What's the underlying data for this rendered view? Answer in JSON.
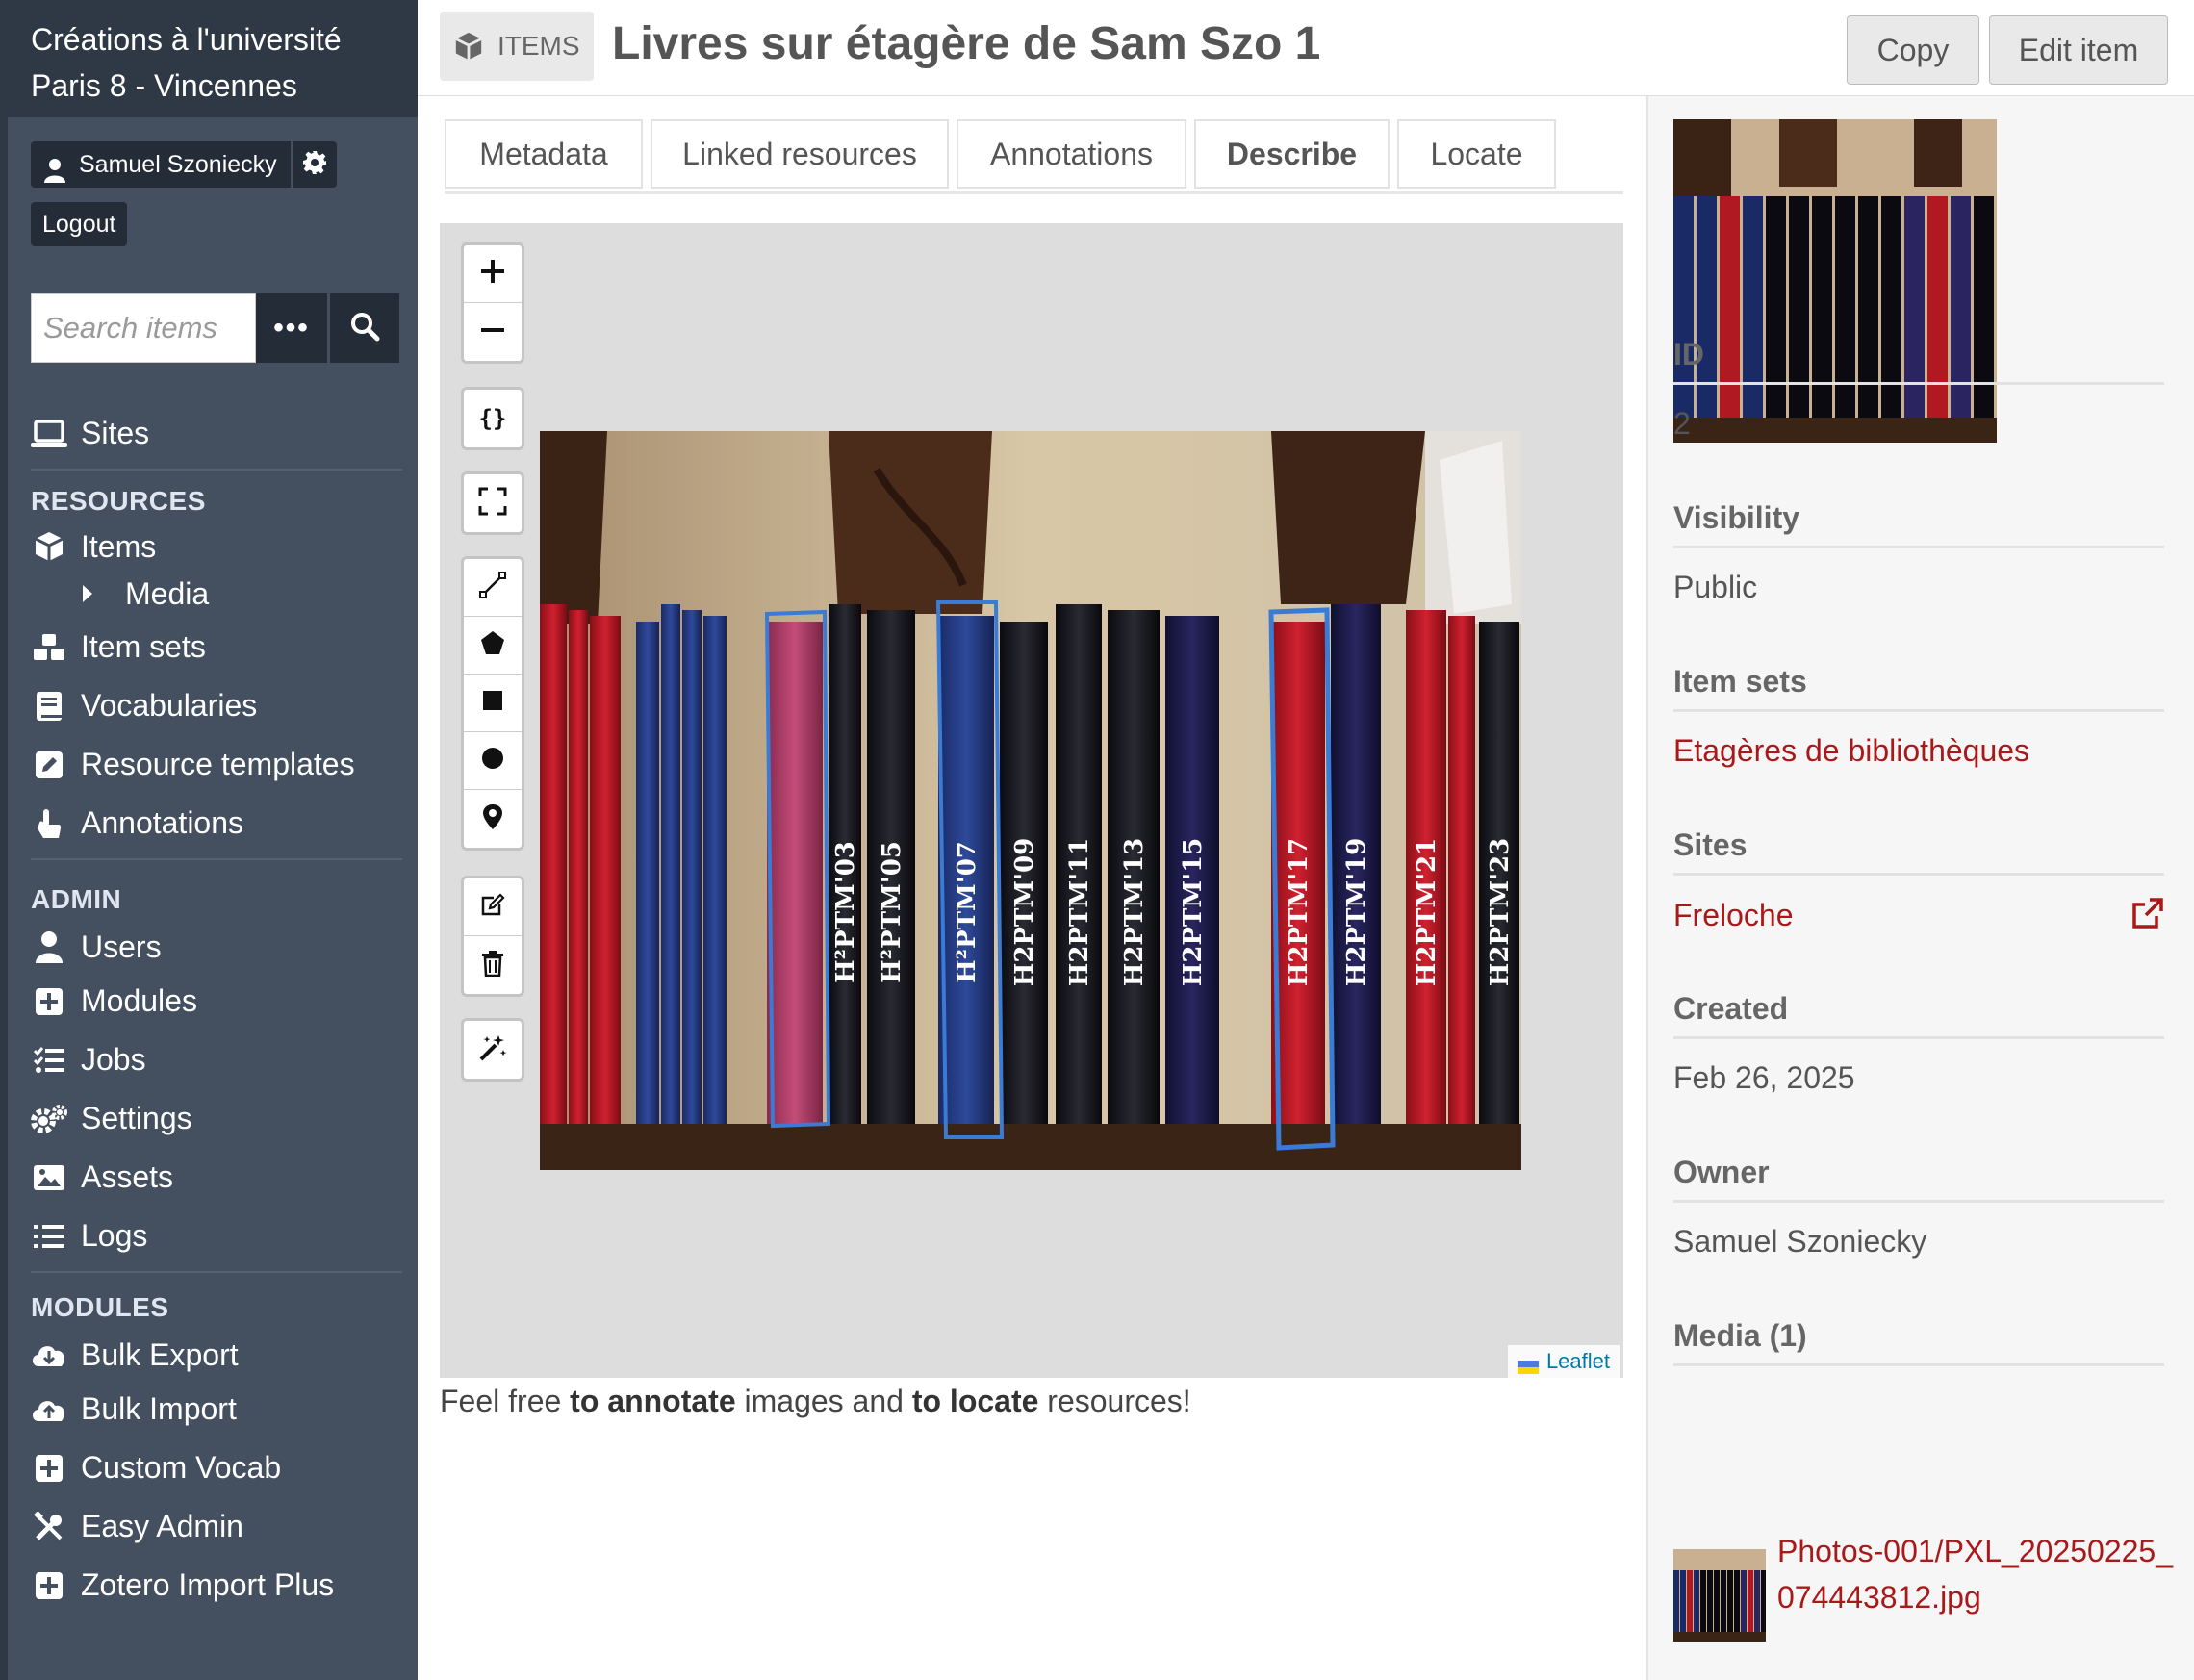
{
  "app": {
    "brand_line1": "Créations à l'université",
    "brand_line2": "Paris 8 - Vincennes"
  },
  "user": {
    "name": "Samuel Szoniecky",
    "logout_label": "Logout"
  },
  "search": {
    "placeholder": "Search items",
    "options_label": "•••"
  },
  "sidebar": {
    "sites_label": "Sites",
    "resources_heading": "RESOURCES",
    "resources": [
      {
        "label": "Items",
        "icon": "cube-icon"
      },
      {
        "label": "Media",
        "icon": "caret-right-icon"
      },
      {
        "label": "Item sets",
        "icon": "cubes-icon"
      },
      {
        "label": "Vocabularies",
        "icon": "book-icon"
      },
      {
        "label": "Resource templates",
        "icon": "edit-icon"
      },
      {
        "label": "Annotations",
        "icon": "hand-pointer-icon"
      }
    ],
    "admin_heading": "ADMIN",
    "admin": [
      {
        "label": "Users",
        "icon": "user-icon"
      },
      {
        "label": "Modules",
        "icon": "plus-square-icon"
      },
      {
        "label": "Jobs",
        "icon": "tasks-icon"
      },
      {
        "label": "Settings",
        "icon": "cogs-icon"
      },
      {
        "label": "Assets",
        "icon": "image-icon"
      },
      {
        "label": "Logs",
        "icon": "list-icon"
      }
    ],
    "modules_heading": "MODULES",
    "modules": [
      {
        "label": "Bulk Export",
        "icon": "cloud-download-icon"
      },
      {
        "label": "Bulk Import",
        "icon": "cloud-upload-icon"
      },
      {
        "label": "Custom Vocab",
        "icon": "plus-square-icon"
      },
      {
        "label": "Easy Admin",
        "icon": "tools-icon"
      },
      {
        "label": "Zotero Import Plus",
        "icon": "plus-square-icon"
      }
    ]
  },
  "header": {
    "badge_label": "ITEMS",
    "title": "Livres sur étagère de Sam Szo 1",
    "copy_label": "Copy",
    "edit_label": "Edit item"
  },
  "tabs": [
    {
      "label": "Metadata",
      "active": false
    },
    {
      "label": "Linked resources",
      "active": false
    },
    {
      "label": "Annotations",
      "active": false
    },
    {
      "label": "Describe",
      "active": true
    },
    {
      "label": "Locate",
      "active": false
    }
  ],
  "viewer": {
    "attribution": "Leaflet",
    "spine_labels": [
      "H²PTM'03",
      "H²PTM'05",
      "H²PTM'07",
      "H2PTM'09",
      "H2PTM'11",
      "H2PTM'13",
      "H2PTM'15",
      "H2PTM'17",
      "H2PTM'19",
      "H2PTM'21",
      "H2PTM'23"
    ]
  },
  "caption": {
    "part1": "Feel free ",
    "bold1": "to annotate",
    "part2": " images and ",
    "bold2": "to locate",
    "part3": " resources!"
  },
  "details": {
    "id_label": "ID",
    "id_value": "2",
    "visibility_label": "Visibility",
    "visibility_value": "Public",
    "item_sets_label": "Item sets",
    "item_sets_value": "Etagères de bibliothèques",
    "sites_label": "Sites",
    "sites_value": "Freloche",
    "created_label": "Created",
    "created_value": "Feb 26, 2025",
    "owner_label": "Owner",
    "owner_value": "Samuel Szoniecky",
    "media_label": "Media (1)",
    "media_value": "Photos-001/PXL_20250225_074443812.jpg"
  },
  "colors": {
    "sidebar_bg": "#444f5f",
    "sidebar_dark": "#2f3845",
    "link_red": "#a91919",
    "viewer_bg": "#dddddd"
  }
}
